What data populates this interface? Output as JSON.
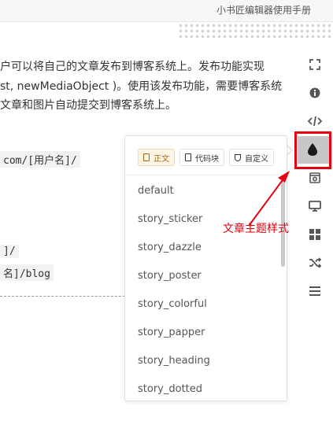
{
  "window": {
    "title": "小书匠编辑器使用手册"
  },
  "document": {
    "paragraph_lines": [
      "户可以将自己的文章发布到博客系统上。发布功能实现",
      "st, newMediaObject )。使用该发布功能，需要博客系统",
      "文章和图片自动提交到博客系统上。"
    ],
    "code_lines": [
      "com/[用户名]/",
      "]/",
      "名]/blog"
    ]
  },
  "theme_popover": {
    "tabs": [
      {
        "label": "正文",
        "icon": "document-icon",
        "active": true
      },
      {
        "label": "代码块",
        "icon": "document-icon",
        "active": false
      },
      {
        "label": "自定义",
        "icon": "shield-icon",
        "active": false
      }
    ],
    "themes": [
      "default",
      "story_sticker",
      "story_dazzle",
      "story_poster",
      "story_colorful",
      "story_papper",
      "story_heading",
      "story_dotted"
    ]
  },
  "sidebar": {
    "icons": [
      "fullscreen-icon",
      "info-icon",
      "code-icon",
      "theme-drop-icon",
      "preview-icon",
      "monitor-icon",
      "grid-icon",
      "shuffle-icon",
      "menu-icon"
    ],
    "active": "theme-drop-icon"
  },
  "annotation": {
    "label": "文章主题样式",
    "color": "#e60012"
  },
  "colors": {
    "accent_red": "#e60012",
    "active_tab_bg": "#fdf4e3",
    "active_tab_text": "#a16a1b"
  }
}
